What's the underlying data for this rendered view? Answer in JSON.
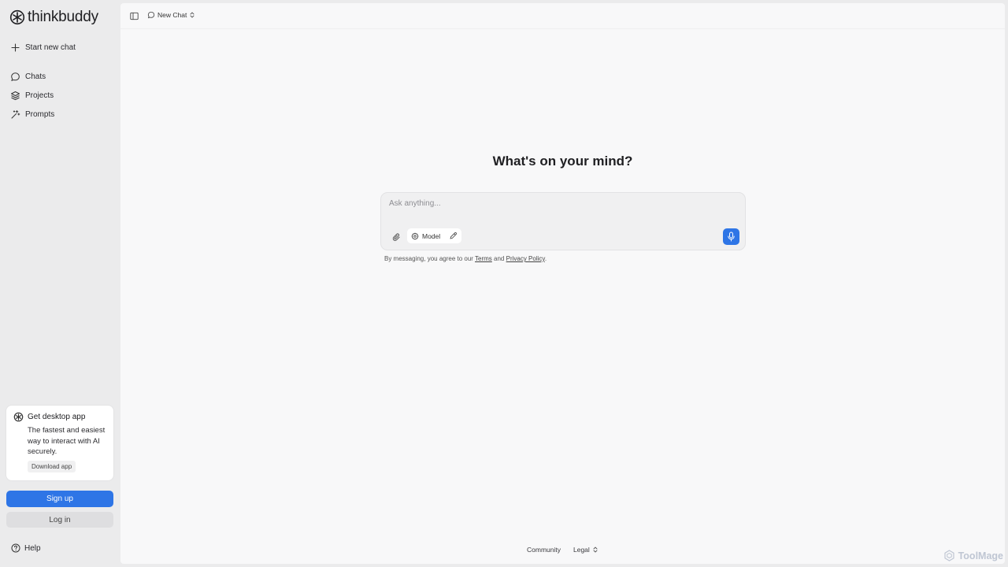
{
  "brand": {
    "name": "thinkbuddy"
  },
  "sidebar": {
    "new_chat": "Start new chat",
    "items": [
      {
        "label": "Chats",
        "icon": "chat-bubble-icon"
      },
      {
        "label": "Projects",
        "icon": "layers-icon"
      },
      {
        "label": "Prompts",
        "icon": "sparkle-wand-icon"
      }
    ],
    "promo": {
      "title": "Get desktop app",
      "text": "The fastest and easiest way to interact with AI securely.",
      "button": "Download app"
    },
    "signup": "Sign up",
    "login": "Log in",
    "help": "Help"
  },
  "topbar": {
    "chat_title": "New Chat"
  },
  "main": {
    "heading": "What's on your mind?",
    "composer": {
      "placeholder": "Ask anything...",
      "model_label": "Model"
    },
    "disclaimer": {
      "prefix": "By messaging, you agree to our ",
      "terms": "Terms",
      "and": " and ",
      "privacy": "Privacy Policy",
      "suffix": "."
    }
  },
  "footer": {
    "community": "Community",
    "legal": "Legal"
  },
  "watermark": "ToolMage",
  "colors": {
    "accent": "#2e75e6",
    "sidebar_bg": "#ebebec",
    "main_bg": "#f8f8f9"
  }
}
